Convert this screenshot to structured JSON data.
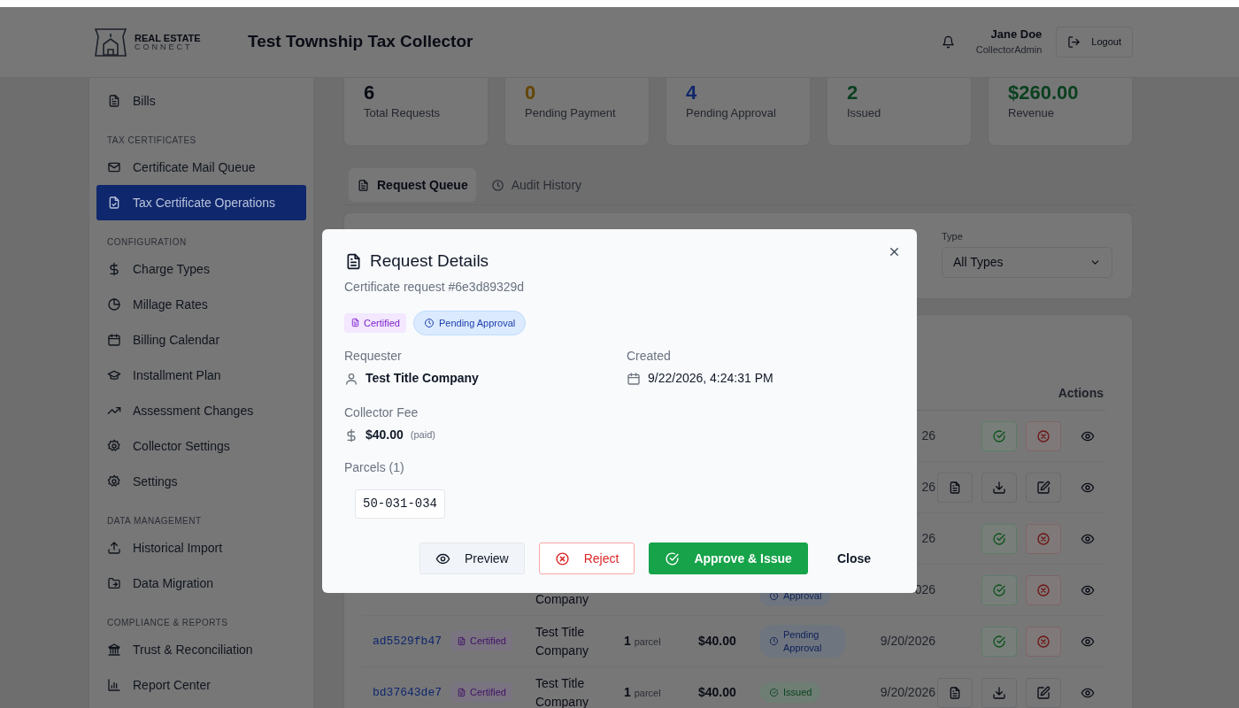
{
  "header": {
    "logo": {
      "line1": "REAL ESTATE",
      "line2": "CONNECT"
    },
    "title": "Test Township Tax Collector",
    "user": {
      "name": "Jane Doe",
      "role": "CollectorAdmin"
    },
    "logout": "Logout"
  },
  "sidebar": {
    "items": [
      {
        "kind": "item",
        "label": "Bills",
        "selected": false
      },
      {
        "kind": "section",
        "label": "TAX CERTIFICATES"
      },
      {
        "kind": "item",
        "label": "Certificate Mail Queue",
        "selected": false
      },
      {
        "kind": "item",
        "label": "Tax Certificate Operations",
        "selected": true
      },
      {
        "kind": "section",
        "label": "CONFIGURATION"
      },
      {
        "kind": "item",
        "label": "Charge Types",
        "selected": false
      },
      {
        "kind": "item",
        "label": "Millage Rates",
        "selected": false
      },
      {
        "kind": "item",
        "label": "Billing Calendar",
        "selected": false
      },
      {
        "kind": "item",
        "label": "Installment Plan",
        "selected": false
      },
      {
        "kind": "item",
        "label": "Assessment Changes",
        "selected": false
      },
      {
        "kind": "item",
        "label": "Collector Settings",
        "selected": false
      },
      {
        "kind": "item",
        "label": "Settings",
        "selected": false
      },
      {
        "kind": "section",
        "label": "DATA MANAGEMENT"
      },
      {
        "kind": "item",
        "label": "Historical Import",
        "selected": false
      },
      {
        "kind": "item",
        "label": "Data Migration",
        "selected": false
      },
      {
        "kind": "section",
        "label": "COMPLIANCE & REPORTS"
      },
      {
        "kind": "item",
        "label": "Trust & Reconciliation",
        "selected": false
      },
      {
        "kind": "item",
        "label": "Report Center",
        "selected": false
      }
    ]
  },
  "stats": [
    {
      "value": "6",
      "label": "Total Requests",
      "color": "#090c14"
    },
    {
      "value": "0",
      "label": "Pending Payment",
      "color": "#654502"
    },
    {
      "value": "4",
      "label": "Pending Approval",
      "color": "#0f276c"
    },
    {
      "value": "2",
      "label": "Issued",
      "color": "#0b401f"
    },
    {
      "value": "$260.00",
      "label": "Revenue",
      "color": "#0b401f"
    }
  ],
  "tabs": [
    {
      "label": "Request Queue",
      "selected": true
    },
    {
      "label": "Audit History",
      "selected": false
    }
  ],
  "filters": {
    "type_label": "Type",
    "type_value": "All Types"
  },
  "table": {
    "actions_header": "Actions",
    "rows": [
      {
        "date": "26",
        "actions": [
          {
            "kind": "approve"
          },
          {
            "kind": "reject"
          },
          {
            "kind": "view"
          }
        ]
      },
      {
        "date": "26",
        "actions": [
          {
            "kind": "document"
          },
          {
            "kind": "download"
          },
          {
            "kind": "edit"
          },
          {
            "kind": "view"
          }
        ]
      },
      {
        "date": "26",
        "actions": [
          {
            "kind": "approve"
          },
          {
            "kind": "reject"
          },
          {
            "kind": "view"
          }
        ]
      },
      {
        "requester_tail": "Company",
        "status": {
          "label": "Approval",
          "kind": "pending"
        },
        "date": "026",
        "actions": [
          {
            "kind": "approve"
          },
          {
            "kind": "reject"
          },
          {
            "kind": "view"
          }
        ]
      },
      {
        "id": "ad5529fb47",
        "type": "Certified",
        "requester": "Test Title Company",
        "parcels": "1",
        "parcels_unit": "parcel",
        "amount": "$40.00",
        "status": {
          "label": "Pending Approval",
          "kind": "pending"
        },
        "date": "9/20/2026",
        "actions": [
          {
            "kind": "approve"
          },
          {
            "kind": "reject"
          },
          {
            "kind": "view"
          }
        ]
      },
      {
        "id": "bd37643de7",
        "type": "Certified",
        "requester": "Test Title Company",
        "parcels": "1",
        "parcels_unit": "parcel",
        "amount": "$40.00",
        "status": {
          "label": "Issued",
          "kind": "issued"
        },
        "date": "9/20/2026",
        "actions": [
          {
            "kind": "document"
          },
          {
            "kind": "download"
          },
          {
            "kind": "edit"
          },
          {
            "kind": "view"
          }
        ]
      }
    ]
  },
  "modal": {
    "title": "Request Details",
    "subtitle": "Certificate request #6e3d89329d",
    "badges": [
      {
        "label": "Certified",
        "kind": "type"
      },
      {
        "label": "Pending Approval",
        "kind": "pending"
      }
    ],
    "fields": [
      {
        "label": "Requester",
        "value": "Test Title Company",
        "kind": "user"
      },
      {
        "label": "Created",
        "value": "9/22/2026, 4:24:31 PM",
        "kind": "date"
      },
      {
        "label": "Collector Fee",
        "value": "$40.00",
        "note": "(paid)",
        "kind": "money"
      }
    ],
    "parcels_label": "Parcels (1)",
    "parcels": [
      "50-031-034"
    ],
    "buttons": [
      {
        "label": "Preview",
        "kind": "preview"
      },
      {
        "label": "Reject",
        "kind": "reject"
      },
      {
        "label": "Approve & Issue",
        "kind": "approve"
      },
      {
        "label": "Close",
        "kind": "close"
      }
    ]
  }
}
